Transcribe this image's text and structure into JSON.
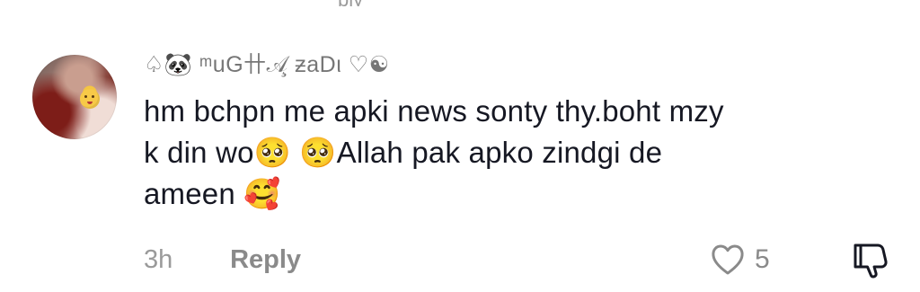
{
  "top_fragment": "ply",
  "comment": {
    "username": "♤🐼 ᵐuG卄𝒜̧ ƶaDι ♡☯",
    "text_lines": [
      "hm bchpn me apki news sonty thy.boht mzy",
      "k din wo🥺 🥺Allah pak apko zindgi de",
      "ameen 🥰"
    ],
    "time": "3h",
    "reply_label": "Reply",
    "likes": "5",
    "avatar": {
      "emoji": "😘"
    }
  },
  "icons": {
    "like": "heart-outline-icon",
    "dislike": "thumbs-down-outline-icon"
  },
  "colors": {
    "text": "#161823",
    "secondary": "#8a8a8a",
    "username": "#767676"
  }
}
